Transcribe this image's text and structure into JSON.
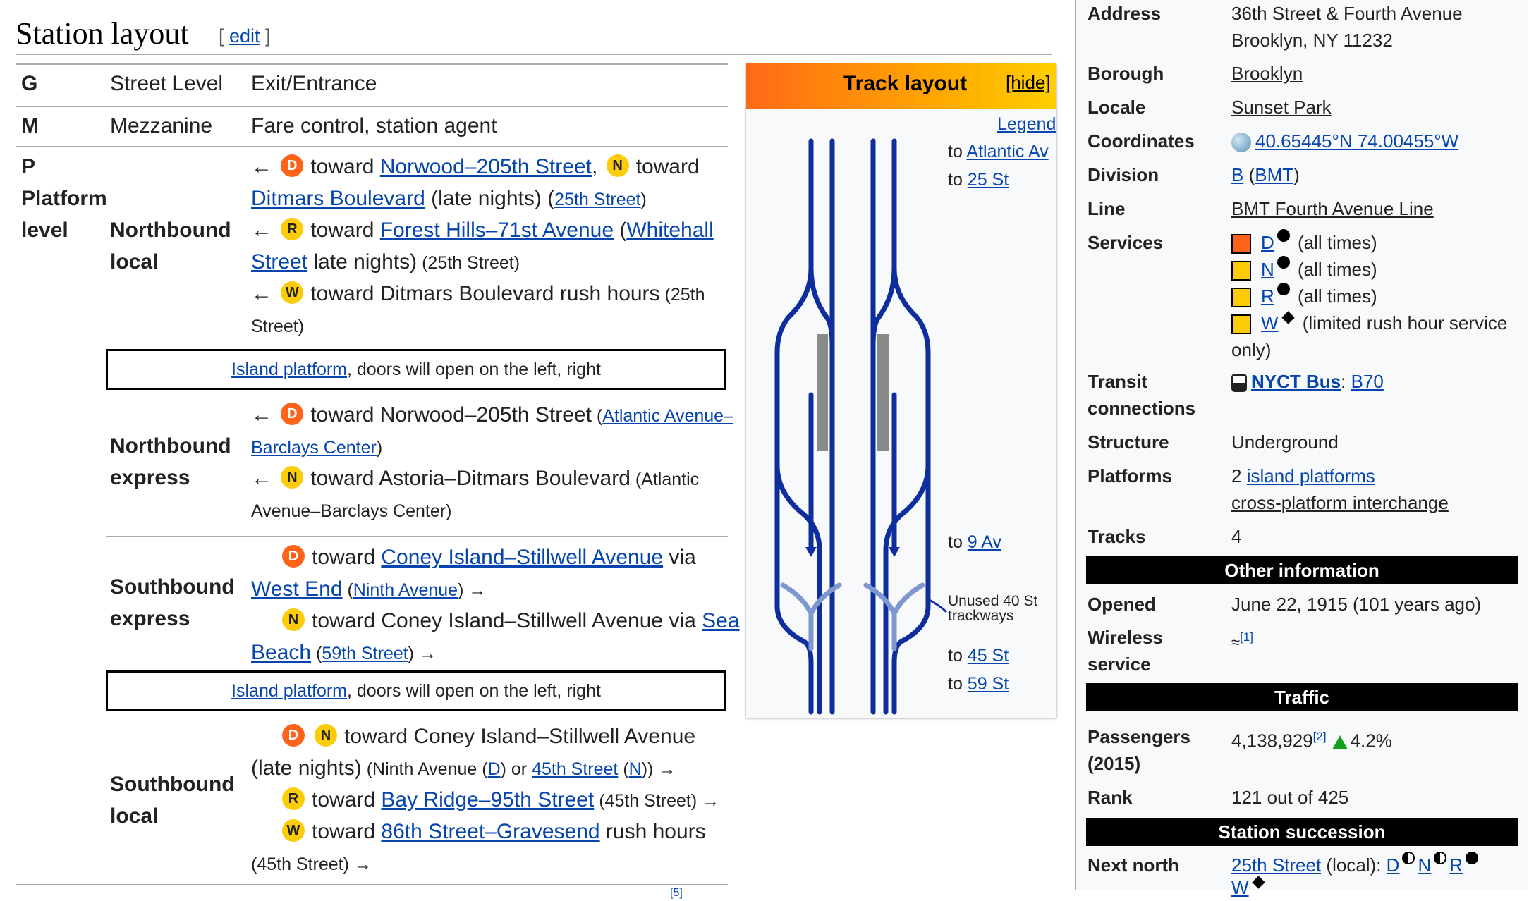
{
  "heading": {
    "title": "Station layout",
    "edit_open": "[ ",
    "edit_label": "edit",
    "edit_close": " ]"
  },
  "layout": {
    "row_g": {
      "code": "G",
      "level": "Street Level",
      "desc": "Exit/Entrance"
    },
    "row_m": {
      "code": "M",
      "level": "Mezzanine",
      "desc": "Fare control, station agent"
    },
    "row_p": {
      "code": "P",
      "level_line1": "Platform",
      "level_line2": "level"
    },
    "nb_local": {
      "label_line1": "Northbound",
      "label_line2": "local",
      "l1_arrow": "←",
      "l1_b1": "D",
      "l1_t1": "toward",
      "l1_link1": "Norwood–205th Street",
      "l1_comma": ",",
      "l1_b2": "N",
      "l1_t2": "toward",
      "l2_link": "Ditmars Boulevard",
      "l2_t": " (late nights) (",
      "l2_link2": "25th Street",
      "l2_close": ")",
      "l3_arrow": "←",
      "l3_b": "R",
      "l3_t": "toward",
      "l3_link": "Forest Hills–71st Avenue",
      "l3_open": " (",
      "l3_link2": "Whitehall",
      "l4_link": "Street",
      "l4_t": " late nights)",
      "l4_s": " (25th Street)",
      "l5_arrow": "←",
      "l5_b": "W",
      "l5_t": "toward Ditmars Boulevard rush hours",
      "l5_s": " (25th",
      "l6_s": "Street)"
    },
    "platform1": {
      "link": "Island platform",
      "text": ", doors will open on the left, right"
    },
    "nb_express": {
      "label_line1": "Northbound",
      "label_line2": "express",
      "l1_arrow": "←",
      "l1_b": "D",
      "l1_t": "toward Norwood–205th Street",
      "l1_open": " (",
      "l1_link": "Atlantic Avenue–",
      "l2_link": "Barclays Center",
      "l2_close": ")",
      "l3_arrow": "←",
      "l3_b": "N",
      "l3_t": "toward Astoria–Ditmars Boulevard",
      "l3_s": " (Atlantic",
      "l4_s": "Avenue–Barclays Center)"
    },
    "sb_express": {
      "label_line1": "Southbound",
      "label_line2": "express",
      "l1_b": "D",
      "l1_t": "toward",
      "l1_link": "Coney Island–Stillwell Avenue",
      "l1_t2": " via",
      "l2_link": "West End",
      "l2_open": " (",
      "l2_link2": "Ninth Avenue",
      "l2_close": ") →",
      "l3_b": "N",
      "l3_t": "toward Coney Island–Stillwell Avenue via",
      "l3_link": "Sea",
      "l4_link": "Beach",
      "l4_open": " (",
      "l4_link2": "59th Street",
      "l4_close": ") →"
    },
    "platform2": {
      "link": "Island platform",
      "text": ", doors will open on the left, right"
    },
    "sb_local": {
      "label_line1": "Southbound",
      "label_line2": "local",
      "l1_b1": "D",
      "l1_b2": "N",
      "l1_t": "toward Coney Island–Stillwell Avenue",
      "l2_t": "(late nights)",
      "l2_s1": " (Ninth Avenue (",
      "l2_link1": "D",
      "l2_s2": ") or ",
      "l2_link2": "45th Street",
      "l2_s3": " (",
      "l2_link3": "N",
      "l2_s4": ")) →",
      "l3_b": "R",
      "l3_t": "toward",
      "l3_link": "Bay Ridge–95th Street",
      "l3_s": " (45th Street) →",
      "l4_b": "W",
      "l4_t": "toward",
      "l4_link": "86th Street–Gravesend",
      "l4_t2": " rush hours",
      "l5_s": "(45th Street) →"
    },
    "footnote_fragment": "[5]"
  },
  "track_layout": {
    "title": "Track layout",
    "hide": "[hide]",
    "legend": "Legend",
    "to1_pre": "to ",
    "to1_link": "Atlantic Av",
    "to2_pre": "to ",
    "to2_link": "25 St",
    "to3_pre": "to ",
    "to3_link": "9 Av",
    "unused_line1": "Unused 40 St",
    "unused_line2": "trackways",
    "to4_pre": "to ",
    "to4_link": "45 St",
    "to5_pre": "to ",
    "to5_link": "59 St",
    "colors": {
      "track": "#0f2e9e",
      "unused": "#7f97cf",
      "platform": "#8a8a8a"
    }
  },
  "infobox": {
    "address_label": "Address",
    "address_line1": "36th Street & Fourth Avenue",
    "address_line2": "Brooklyn, NY 11232",
    "borough_label": "Borough",
    "borough_value": "Brooklyn",
    "locale_label": "Locale",
    "locale_value": "Sunset Park",
    "coords_label": "Coordinates",
    "coords_value": "40.65445°N 74.00455°W",
    "division_label": "Division",
    "division_b": "B",
    "division_open": " (",
    "division_bmt": "BMT",
    "division_close": ")",
    "line_label": "Line",
    "line_value": "BMT Fourth Avenue Line",
    "services_label": "Services",
    "services": [
      {
        "letter": "D",
        "color": "#ff6319",
        "marker": "dot",
        "text": " (all times)"
      },
      {
        "letter": "N",
        "color": "#fccc0a",
        "marker": "dot",
        "text": " (all times)"
      },
      {
        "letter": "R",
        "color": "#fccc0a",
        "marker": "dot",
        "text": " (all times)"
      },
      {
        "letter": "W",
        "color": "#fccc0a",
        "marker": "diamond",
        "text": " (limited rush hour service"
      }
    ],
    "services_overflow": "only)",
    "transit_label_line1": "Transit",
    "transit_label_line2": "connections",
    "transit_bus": "NYCT Bus",
    "transit_colon": ": ",
    "transit_route": "B70",
    "structure_label": "Structure",
    "structure_value": "Underground",
    "platforms_label": "Platforms",
    "platforms_count": "2 ",
    "platforms_link": "island platforms",
    "platforms_link2": "cross-platform interchange",
    "tracks_label": "Tracks",
    "tracks_value": "4",
    "band_other": "Other information",
    "opened_label": "Opened",
    "opened_value": "June 22, 1915 (101 years ago)",
    "wireless_label_line1": "Wireless",
    "wireless_label_line2": "service",
    "wireless_ref": "[1]",
    "band_traffic": "Traffic",
    "passengers_label_line1": "Passengers",
    "passengers_label_line2": "(2015)",
    "passengers_value": "4,138,929",
    "passengers_ref": "[2]",
    "passengers_change": "4.2%",
    "rank_label": "Rank",
    "rank_value": "121 out of 425",
    "band_succession": "Station succession",
    "next_north_label": "Next north",
    "next_north_link": "25th Street",
    "next_north_text": " (local): ",
    "next_north_d": "D",
    "next_north_n": "N",
    "next_north_r": "R",
    "next_north_w": "W"
  }
}
